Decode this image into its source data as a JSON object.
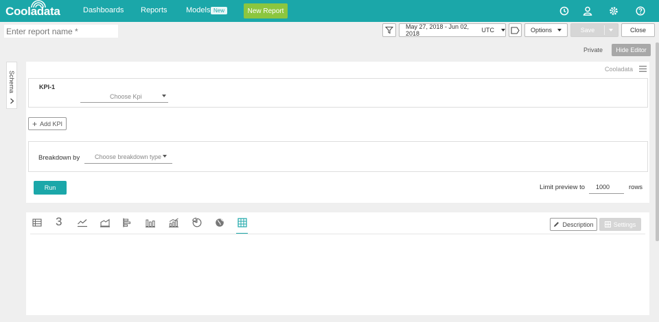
{
  "nav": {
    "logo": "Cooladata",
    "items": [
      {
        "label": "Dashboards"
      },
      {
        "label": "Reports"
      },
      {
        "label": "Models",
        "badge": "New"
      }
    ],
    "new_report": "New Report",
    "icons": [
      "clock-icon",
      "user-icon",
      "gear-icon",
      "help-icon"
    ]
  },
  "toolbar": {
    "report_name_placeholder": "Enter report name *",
    "date_range": "May 27, 2018 - Jun 02, 2018",
    "timezone": "UTC",
    "options": "Options",
    "save": "Save",
    "close": "Close",
    "private": "Private",
    "hide_editor": "Hide Editor"
  },
  "schema": {
    "label": "Schema"
  },
  "editor": {
    "source_label": "Cooladata",
    "kpi": {
      "label": "KPI-1",
      "select_placeholder": "Choose Kpi"
    },
    "add_kpi": "Add KPI",
    "breakdown": {
      "label": "Breakdown by",
      "select_placeholder": "Choose breakdown type"
    },
    "run": "Run",
    "limit": {
      "label": "Limit preview to",
      "value": "1000",
      "unit": "rows"
    }
  },
  "visualization": {
    "types": [
      "table-icon",
      "number-icon",
      "line-chart-icon",
      "area-chart-icon",
      "bar-chart-icon",
      "column-chart-icon",
      "combo-chart-icon",
      "pie-chart-icon",
      "map-icon",
      "grid-icon"
    ],
    "number_glyph": "3",
    "active": "grid-icon",
    "description": "Description",
    "settings": "Settings"
  },
  "colors": {
    "brand": "#1ba7a9",
    "new_report": "#8cc63f"
  }
}
